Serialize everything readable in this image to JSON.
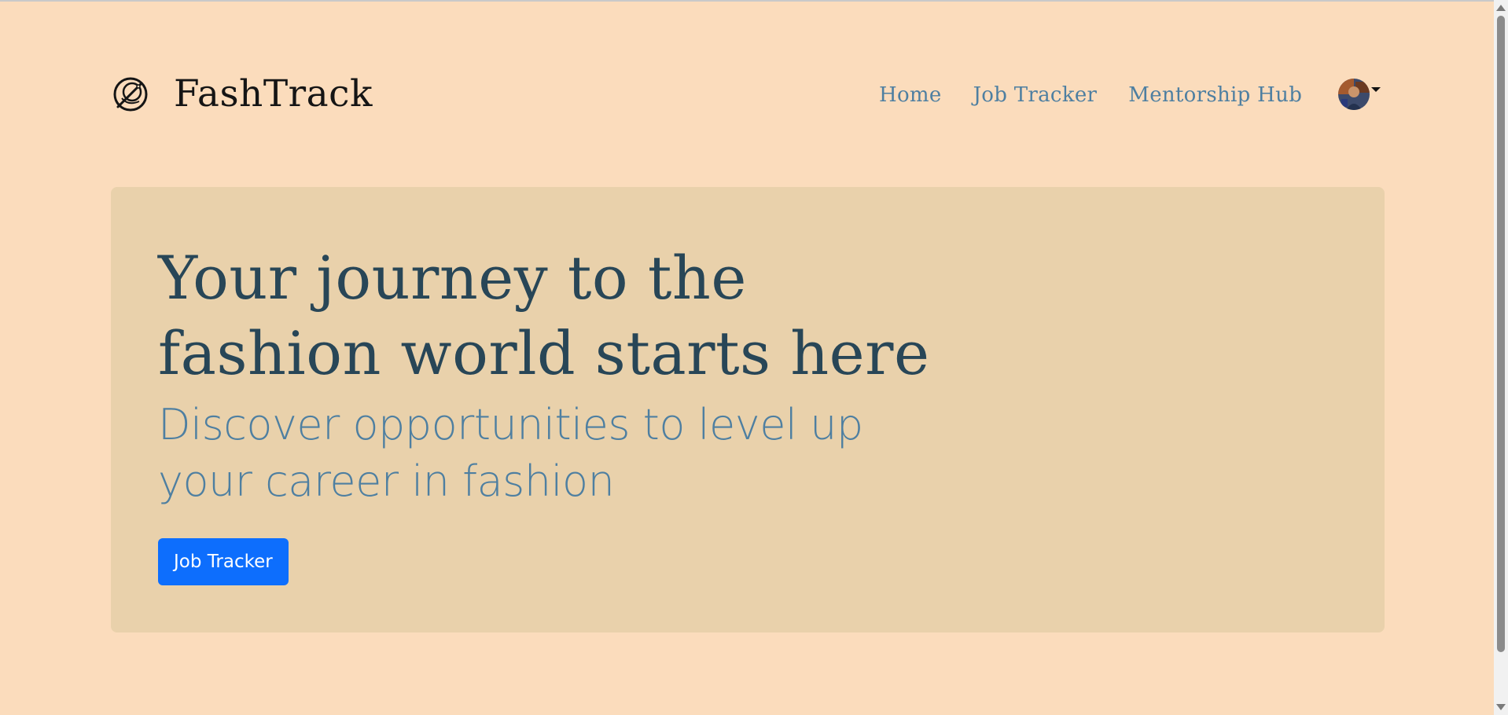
{
  "brand": {
    "name": "FashTrack",
    "logo_icon": "needle-thread-logo-icon"
  },
  "nav": {
    "items": [
      {
        "label": "Home"
      },
      {
        "label": "Job Tracker"
      },
      {
        "label": "Mentorship Hub"
      }
    ]
  },
  "profile": {
    "avatar_icon": "user-avatar",
    "dropdown_icon": "caret-down-icon"
  },
  "hero": {
    "title": "Your journey to the fashion world starts here",
    "subtitle": "Discover opportunities to level up your career in fashion",
    "button_label": "Job Tracker"
  },
  "colors": {
    "page_background": "#fbdcbc",
    "hero_background": "#e9d1ab",
    "title_color": "#284657",
    "link_color": "#4e7fa1",
    "button_color": "#0d6efd"
  }
}
